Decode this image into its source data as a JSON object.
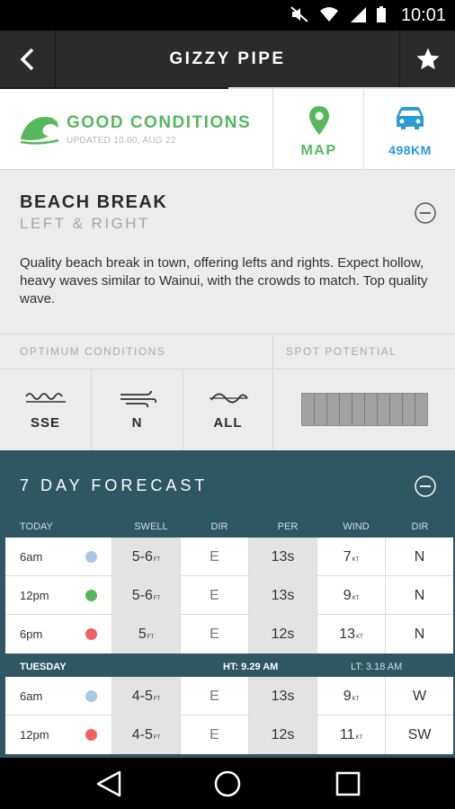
{
  "status_bar": {
    "time": "10:01"
  },
  "header": {
    "title": "GIZZY PIPE"
  },
  "conditions": {
    "label": "GOOD CONDITIONS",
    "updated": "UPDATED 10.00, AUG 22",
    "map_label": "MAP",
    "distance_label": "498KM",
    "accent_green": "#57b75e",
    "accent_blue": "#2a9ad8"
  },
  "break_info": {
    "type": "BEACH BREAK",
    "direction": "LEFT & RIGHT",
    "description": "Quality beach break in town, offering lefts and rights. Expect hollow, heavy waves similar to Wainui, with the crowds to match. Top quality wave."
  },
  "optimum": {
    "header": "OPTIMUM CONDITIONS",
    "swell": "SSE",
    "wind": "N",
    "tide": "ALL",
    "potential_header": "SPOT POTENTIAL"
  },
  "forecast": {
    "title": "7 DAY FORECAST",
    "columns": {
      "day": "TODAY",
      "swell": "SWELL",
      "dir": "DIR",
      "per": "PER",
      "wind": "WIND",
      "wind_dir": "DIR"
    },
    "today_rows": [
      {
        "time": "6am",
        "dot": "#a8c8e8",
        "swell": "5-6",
        "swell_unit": "FT",
        "dir": "E",
        "per": "13s",
        "wind": "7",
        "wind_unit": "KT",
        "wind_dir": "N"
      },
      {
        "time": "12pm",
        "dot": "#55b65c",
        "swell": "5-6",
        "swell_unit": "FT",
        "dir": "E",
        "per": "13s",
        "wind": "9",
        "wind_unit": "KT",
        "wind_dir": "N"
      },
      {
        "time": "6pm",
        "dot": "#f0625c",
        "swell": "5",
        "swell_unit": "FT",
        "dir": "E",
        "per": "12s",
        "wind": "13",
        "wind_unit": "KT",
        "wind_dir": "N"
      }
    ],
    "tuesday": {
      "label": "TUESDAY",
      "high_tide": "HT: 9.29 AM",
      "low_tide": "LT: 3.18 AM"
    },
    "tuesday_rows": [
      {
        "time": "6am",
        "dot": "#a8c8e8",
        "swell": "4-5",
        "swell_unit": "FT",
        "dir": "E",
        "per": "13s",
        "wind": "9",
        "wind_unit": "KT",
        "wind_dir": "W"
      },
      {
        "time": "12pm",
        "dot": "#f0625c",
        "swell": "4-5",
        "swell_unit": "FT",
        "dir": "E",
        "per": "12s",
        "wind": "11",
        "wind_unit": "KT",
        "wind_dir": "SW"
      }
    ]
  }
}
